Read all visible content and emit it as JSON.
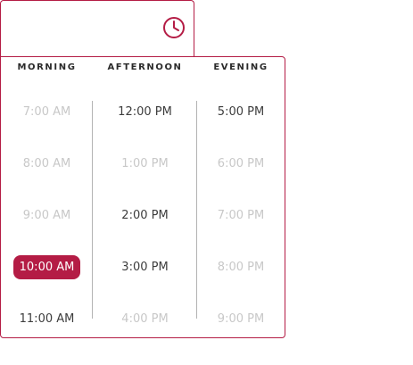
{
  "icons": {
    "clock": "clock-icon"
  },
  "colors": {
    "accent": "#b41c45",
    "text": "#3d3d3d",
    "muted": "#c8c8c8",
    "divider": "#b3b3b3"
  },
  "columns": [
    {
      "header": "MORNING",
      "slots": [
        {
          "label": "7:00 AM",
          "state": "unavailable"
        },
        {
          "label": "8:00 AM",
          "state": "unavailable"
        },
        {
          "label": "9:00 AM",
          "state": "unavailable"
        },
        {
          "label": "10:00 AM",
          "state": "selected"
        },
        {
          "label": "11:00 AM",
          "state": "available"
        }
      ]
    },
    {
      "header": "AFTERNOON",
      "slots": [
        {
          "label": "12:00 PM",
          "state": "available"
        },
        {
          "label": "1:00 PM",
          "state": "unavailable"
        },
        {
          "label": "2:00 PM",
          "state": "available"
        },
        {
          "label": "3:00 PM",
          "state": "available"
        },
        {
          "label": "4:00 PM",
          "state": "unavailable"
        }
      ]
    },
    {
      "header": "EVENING",
      "slots": [
        {
          "label": "5:00 PM",
          "state": "available"
        },
        {
          "label": "6:00 PM",
          "state": "unavailable"
        },
        {
          "label": "7:00 PM",
          "state": "unavailable"
        },
        {
          "label": "8:00 PM",
          "state": "unavailable"
        },
        {
          "label": "9:00 PM",
          "state": "unavailable"
        }
      ]
    }
  ]
}
